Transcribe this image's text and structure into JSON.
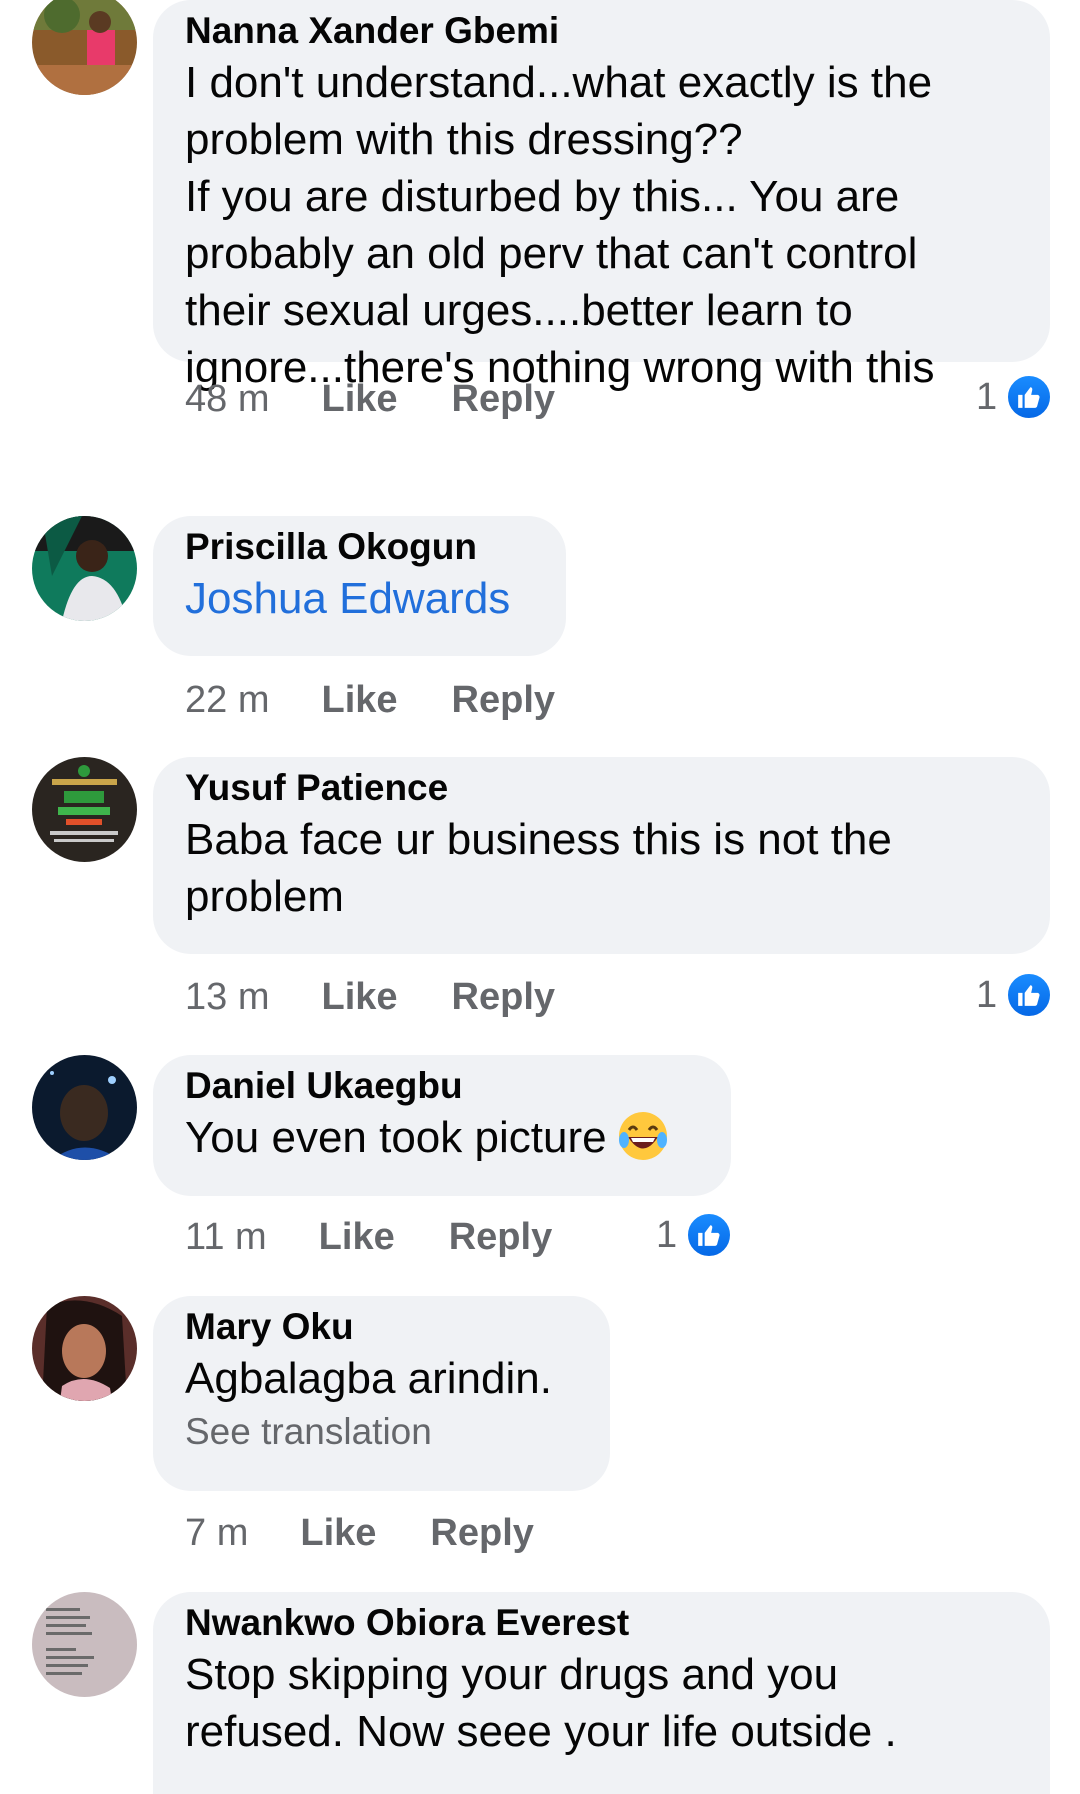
{
  "comments": [
    {
      "author": "Nanna Xander Gbemi",
      "lines": [
        "I don't understand...what exactly is the",
        "problem with this dressing??",
        "If you are disturbed by this... You are",
        "probably an old perv that can't control",
        "their sexual urges....better learn to",
        "ignore...there's nothing wrong with this"
      ],
      "time": "48 m",
      "like_label": "Like",
      "reply_label": "Reply",
      "reaction_count": "1",
      "reaction_icon": "like-icon"
    },
    {
      "author": "Priscilla Okogun",
      "mention": "Joshua Edwards",
      "time": "22 m",
      "like_label": "Like",
      "reply_label": "Reply"
    },
    {
      "author": "Yusuf Patience",
      "lines": [
        "Baba face ur business this is not the",
        "problem"
      ],
      "time": "13 m",
      "like_label": "Like",
      "reply_label": "Reply",
      "reaction_count": "1",
      "reaction_icon": "like-icon"
    },
    {
      "author": "Daniel Ukaegbu",
      "text": "You even took picture",
      "emoji": "laughing-tears-emoji",
      "time": "11 m",
      "like_label": "Like",
      "reply_label": "Reply",
      "reaction_count": "1",
      "reaction_icon": "like-icon"
    },
    {
      "author": "Mary Oku",
      "text": "Agbalagba arindin.",
      "translation_label": "See translation",
      "time": "7 m",
      "like_label": "Like",
      "reply_label": "Reply"
    },
    {
      "author": "Nwankwo Obiora Everest",
      "lines": [
        "Stop skipping your drugs and you",
        "refused. Now seee your life outside ."
      ]
    }
  ],
  "colors": {
    "bubble": "#f0f2f5",
    "meta_text": "#65676b",
    "mention": "#216fdb",
    "like_badge": "#1877f2"
  }
}
